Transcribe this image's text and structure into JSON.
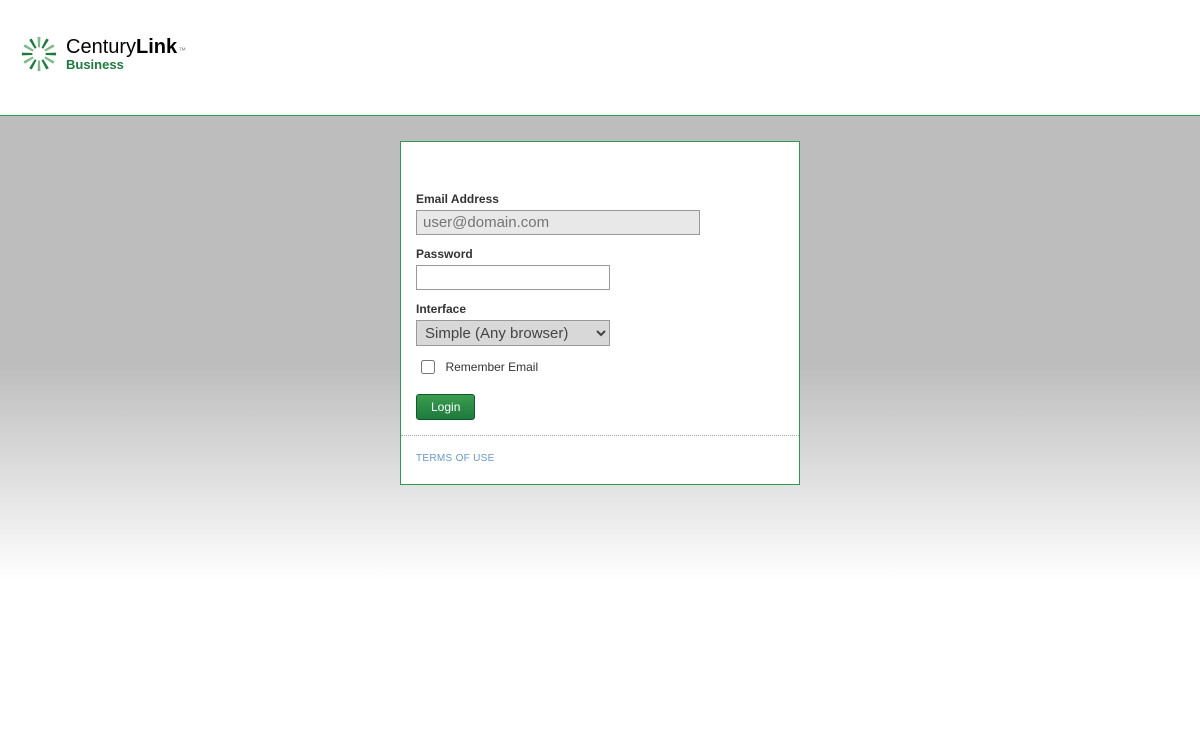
{
  "logo": {
    "part1": "Century",
    "part2": "Link",
    "tm": "™",
    "subtext": "Business"
  },
  "form": {
    "email_label": "Email Address",
    "email_placeholder": "user@domain.com",
    "email_value": "",
    "password_label": "Password",
    "password_value": "",
    "interface_label": "Interface",
    "interface_selected": "Simple (Any browser)",
    "remember_label": "Remember Email",
    "login_button": "Login"
  },
  "footer": {
    "terms": "TERMS OF USE"
  }
}
